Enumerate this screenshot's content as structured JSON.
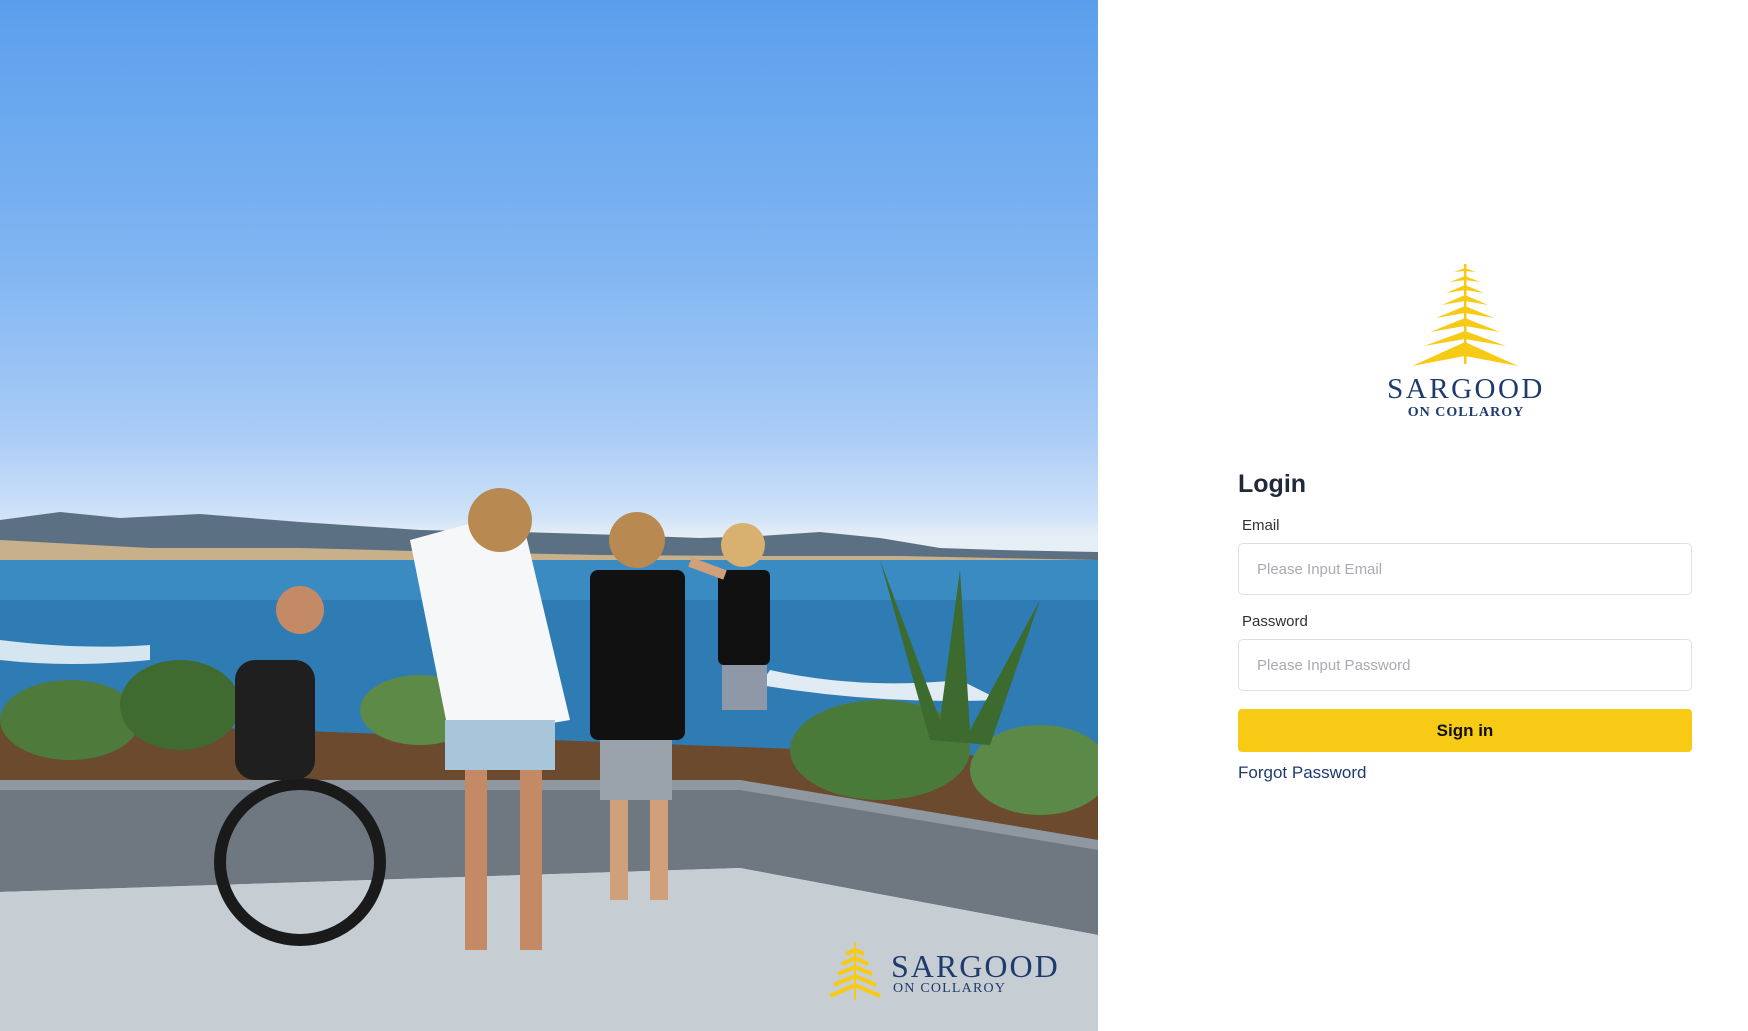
{
  "hero": {
    "logo_brand": "SARGOOD",
    "logo_sub": "ON COLLAROY"
  },
  "logo": {
    "brand": "SARGOOD",
    "sub": "ON COLLAROY",
    "icon": "fern-tree-icon",
    "accent_color": "#f7cb15",
    "brand_color": "#1d3b6d"
  },
  "login": {
    "title": "Login",
    "email_label": "Email",
    "email_placeholder": "Please Input Email",
    "password_label": "Password",
    "password_placeholder": "Please Input Password",
    "submit_label": "Sign in",
    "forgot_label": "Forgot Password"
  }
}
